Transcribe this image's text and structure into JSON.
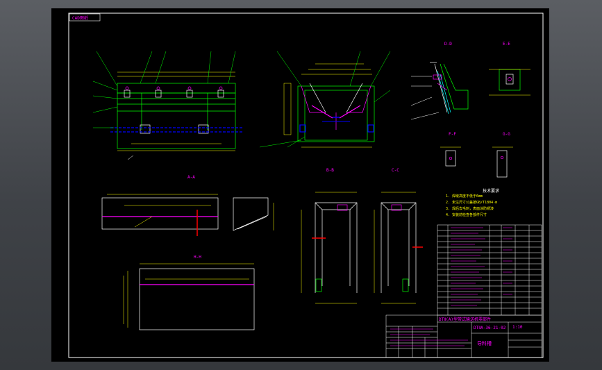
{
  "drawing": {
    "corner_tag": "CAD图纸",
    "section_labels": {
      "s1": "A-A",
      "s2": "B-B",
      "s3": "C-C",
      "s4": "D-D",
      "s5": "E-E",
      "s6": "F-F",
      "s7": "G-G",
      "s8": "H-H"
    },
    "notes_title": "技术要求",
    "notes": [
      "1. 焊缝高度不低于6mm",
      "2. 未注尺寸公差按GB/T1804-m",
      "3. 焊后去毛刺，表面涂防锈漆",
      "4. 安装前检查各部件尺寸"
    ],
    "title_block": {
      "product_title": "DTⅡ(A)型带式输送机零部件",
      "drawing_code": "DTⅡA-36-21-02",
      "part_name": "导料槽",
      "scale": "1:10"
    }
  },
  "colors": {
    "background": "#000000",
    "outline": "#ffffff",
    "geometry": "#00ff00",
    "dimension": "#ffff00",
    "hidden": "#0000ff",
    "annotation": "#ff00ff",
    "cut": "#ff0000"
  }
}
